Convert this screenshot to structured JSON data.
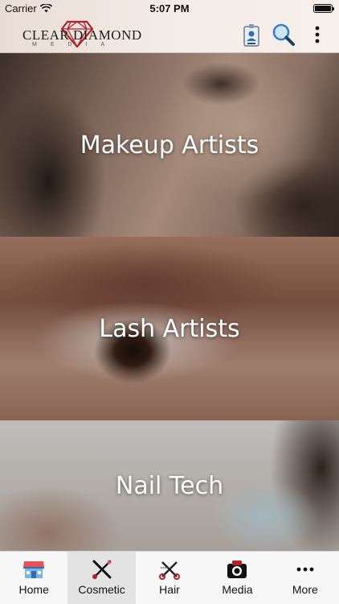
{
  "status_bar": {
    "carrier": "Carrier",
    "time": "5:07 PM"
  },
  "header": {
    "logo_text": "CLEAR DIAMOND",
    "logo_subtext": "MEDIA",
    "icons": [
      "id-badge-icon",
      "search-icon",
      "more-vertical-icon"
    ]
  },
  "categories": [
    {
      "label": "Makeup Artists"
    },
    {
      "label": "Lash Artists"
    },
    {
      "label": "Nail Tech"
    }
  ],
  "tabs": [
    {
      "label": "Home",
      "icon": "storefront-icon",
      "active": false
    },
    {
      "label": "Cosmetic",
      "icon": "makeup-brush-icon",
      "active": true
    },
    {
      "label": "Hair",
      "icon": "scissors-comb-icon",
      "active": false
    },
    {
      "label": "Media",
      "icon": "camera-icon",
      "active": false
    },
    {
      "label": "More",
      "icon": "more-horizontal-icon",
      "active": false
    }
  ],
  "colors": {
    "brand_red": "#b2202a",
    "tab_active_bg": "#e3e3e3",
    "accent_blue": "#2c6fb3"
  }
}
